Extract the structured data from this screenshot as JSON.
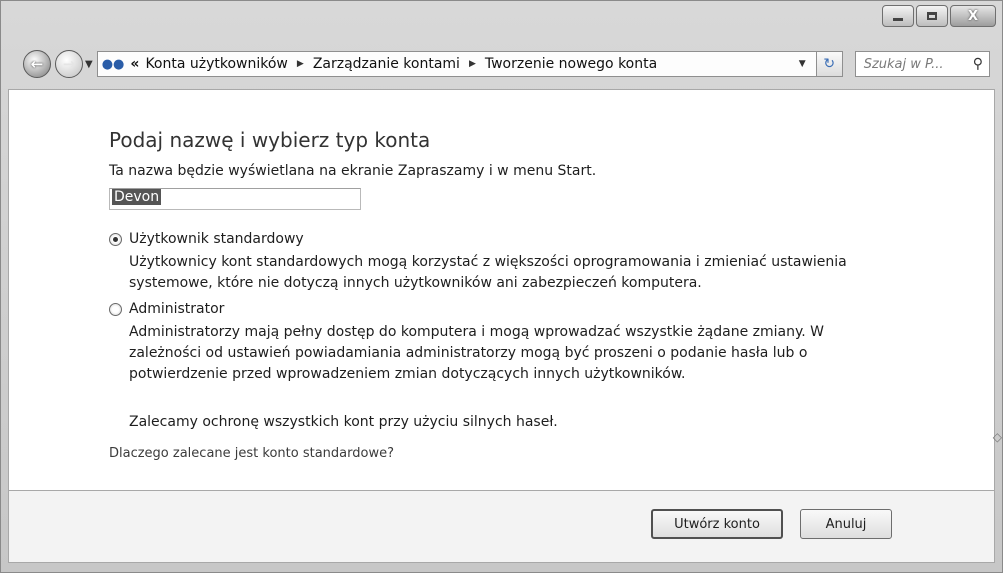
{
  "window": {
    "caption": {
      "minimize_icon": "minimize-icon",
      "maximize_icon": "maximize-icon",
      "close_label": "X"
    }
  },
  "nav": {
    "back_glyph": "←",
    "forward_glyph": "→",
    "address": {
      "icon": "users-icon",
      "overflow": "«",
      "crumbs": [
        "Konta użytkowników",
        "Zarządzanie kontami",
        "Tworzenie nowego konta"
      ]
    },
    "search_placeholder": "Szukaj w P..."
  },
  "content": {
    "title": "Podaj nazwę i wybierz typ konta",
    "description": "Ta nazwa będzie wyświetlana na ekranie Zapraszamy i w menu Start.",
    "name_value": "Devon",
    "options": [
      {
        "label": "Użytkownik standardowy",
        "checked": true,
        "description_lines": [
          "Użytkownicy kont standardowych mogą korzystać z większości oprogramowania i zmieniać ustawienia",
          "systemowe, które nie dotyczą innych użytkowników ani zabezpieczeń komputera."
        ]
      },
      {
        "label": "Administrator",
        "checked": false,
        "description_lines": [
          "Administratorzy mają pełny dostęp do komputera i mogą wprowadzać wszystkie żądane zmiany. W",
          "zależności od ustawień powiadamiania administratorzy mogą być proszeni o podanie hasła lub o",
          "potwierdzenie przed wprowadzeniem zmian dotyczących innych użytkowników."
        ]
      }
    ],
    "recommendation": "Zalecamy ochronę wszystkich kont przy użyciu silnych haseł.",
    "why_link": "Dlaczego zalecane jest konto standardowe?"
  },
  "footer": {
    "create_label": "Utwórz konto",
    "cancel_label": "Anuluj"
  }
}
